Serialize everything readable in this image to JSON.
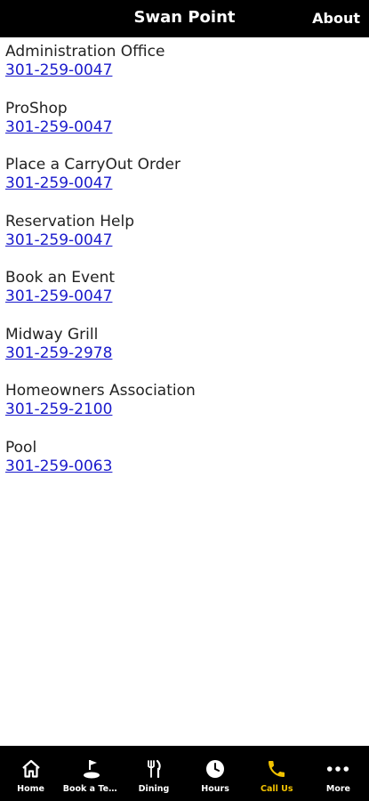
{
  "header": {
    "title": "Swan Point",
    "about_label": "About"
  },
  "contacts": [
    {
      "name": "Administration Office",
      "phone": "301-259-0047"
    },
    {
      "name": "ProShop",
      "phone": "301-259-0047"
    },
    {
      "name": "Place a CarryOut Order",
      "phone": "301-259-0047"
    },
    {
      "name": "Reservation Help",
      "phone": "301-259-0047"
    },
    {
      "name": "Book an Event",
      "phone": "301-259-0047"
    },
    {
      "name": "Midway Grill",
      "phone": "301-259-2978"
    },
    {
      "name": "Homeowners Association",
      "phone": "301-259-2100"
    },
    {
      "name": "Pool",
      "phone": "301-259-0063"
    }
  ],
  "tabs": [
    {
      "label": "Home",
      "icon": "home-icon"
    },
    {
      "label": "Book a Tee ...",
      "icon": "golf-icon"
    },
    {
      "label": "Dining",
      "icon": "fork-knife-icon"
    },
    {
      "label": "Hours",
      "icon": "clock-icon"
    },
    {
      "label": "Call Us",
      "icon": "phone-icon",
      "active": true
    },
    {
      "label": "More",
      "icon": "more-icon"
    }
  ],
  "colors": {
    "bar": "#000000",
    "active": "#f2c200",
    "link": "#1a1acc"
  }
}
